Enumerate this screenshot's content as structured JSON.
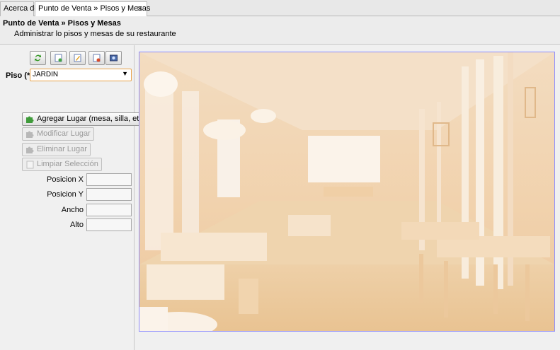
{
  "tabs": [
    {
      "label": "Acerca de"
    },
    {
      "label": "Punto de Venta » Pisos y Mesas"
    }
  ],
  "header": {
    "title": "Punto de Venta » Pisos y Mesas",
    "subtitle": "Administrar lo pisos y mesas de su restaurante"
  },
  "toolbar": {
    "icons": [
      "refresh-icon",
      "new-floor-icon",
      "edit-floor-icon",
      "delete-floor-icon",
      "image-icon"
    ]
  },
  "floor": {
    "label": "Piso (*)",
    "selected": "JARDIN"
  },
  "actions": {
    "add": "Agregar Lugar (mesa, silla, etc)",
    "modify": "Modificar Lugar",
    "delete": "Eliminar Lugar",
    "clear": "Limpiar Selección"
  },
  "fields": {
    "pos_x": "Posicion X",
    "pos_y": "Posicion Y",
    "width": "Ancho",
    "height": "Alto"
  },
  "colors": {
    "accent_border": "#e8a248",
    "canvas_border": "#8c8cff"
  }
}
